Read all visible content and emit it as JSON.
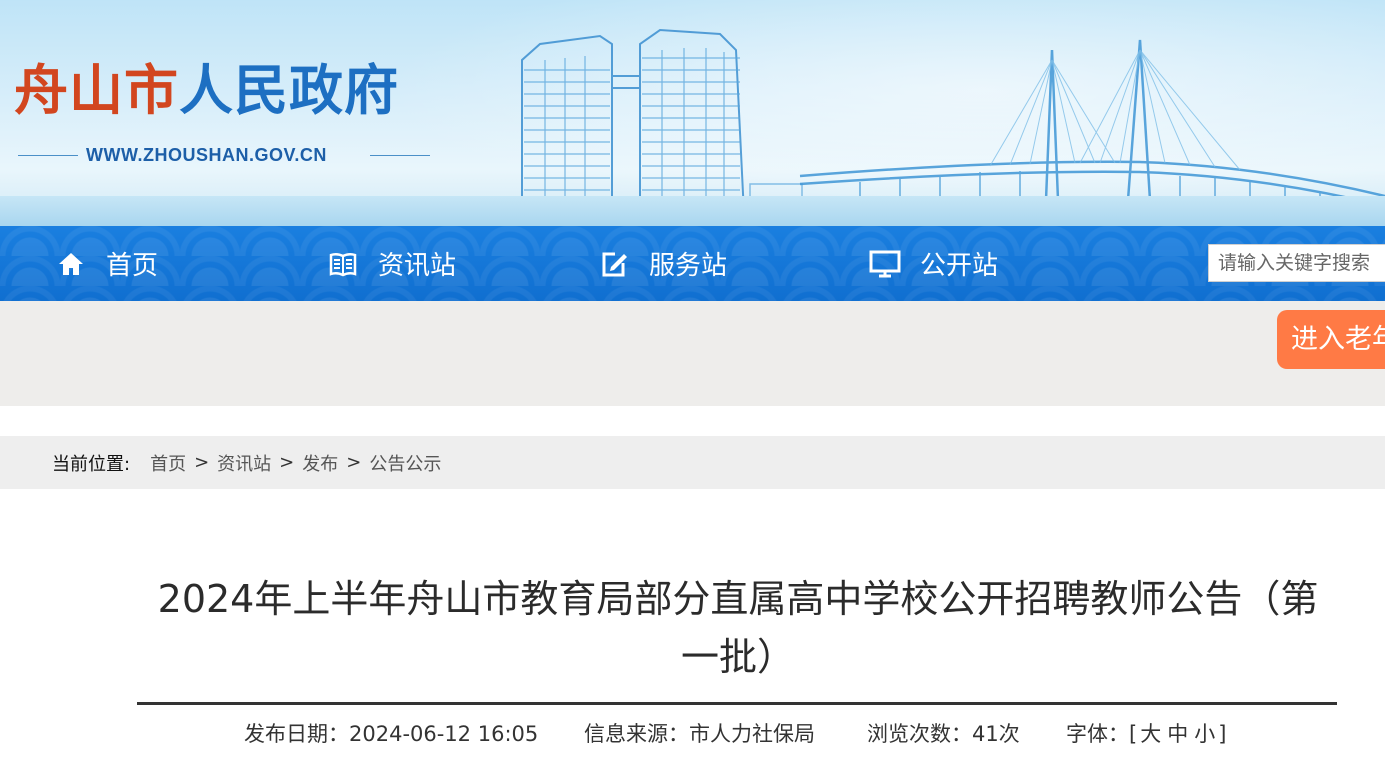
{
  "header": {
    "site_title_red": "舟山市",
    "site_title_blue": "人民政府",
    "site_url": "WWW.ZHOUSHAN.GOV.CN",
    "colors": {
      "title_red": "#d2461f",
      "title_blue": "#1d6fc2"
    }
  },
  "nav": {
    "items": [
      {
        "label": "首页",
        "icon": "home-icon"
      },
      {
        "label": "资讯站",
        "icon": "book-icon"
      },
      {
        "label": "服务站",
        "icon": "edit-icon"
      },
      {
        "label": "公开站",
        "icon": "monitor-icon"
      }
    ],
    "search_placeholder": "请输入关键字搜索",
    "bg_color": "#1478d8"
  },
  "elder_mode_button": {
    "label": "进入老年",
    "color": "#ff7a45"
  },
  "breadcrumb": {
    "label": "当前位置:",
    "items": [
      "首页",
      "资讯站",
      "发布",
      "公告公示"
    ],
    "separator": ">"
  },
  "article": {
    "title": "2024年上半年舟山市教育局部分直属高中学校公开招聘教师公告（第一批）",
    "publish_label": "发布日期：",
    "publish_date": "2024-06-12 16:05",
    "source_label": "信息来源：",
    "source": "市人力社保局",
    "views_label": "浏览次数：",
    "views": "41次",
    "font_label": "字体：",
    "font_open": "[",
    "font_large": "大",
    "font_medium": "中",
    "font_small": "小",
    "font_close": "]"
  }
}
